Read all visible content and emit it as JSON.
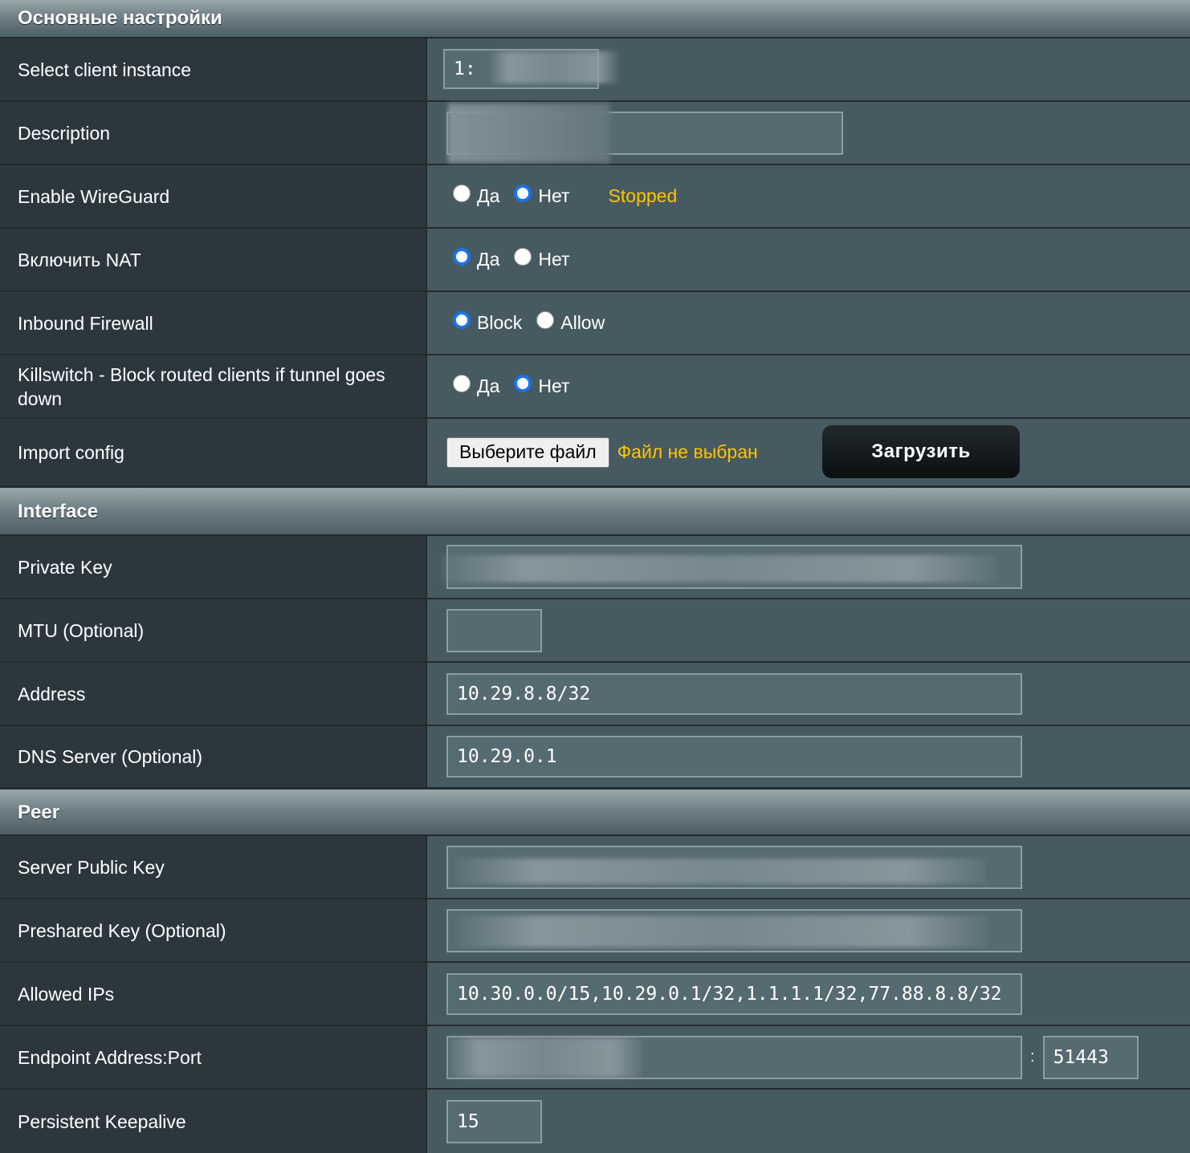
{
  "sections": {
    "basic": "Основные настройки",
    "interface": "Interface",
    "peer": "Peer"
  },
  "rows": {
    "client_instance": {
      "label": "Select client instance",
      "value": "1:"
    },
    "description": {
      "label": "Description",
      "value": ""
    },
    "enable_wireguard": {
      "label": "Enable WireGuard",
      "yes": "Да",
      "no": "Нет",
      "selected": "Нет",
      "status": "Stopped"
    },
    "nat": {
      "label": "Включить NAT",
      "yes": "Да",
      "no": "Нет",
      "selected": "Да"
    },
    "inbound_firewall": {
      "label": "Inbound Firewall",
      "block": "Block",
      "allow": "Allow",
      "selected": "Block"
    },
    "killswitch": {
      "label": "Killswitch - Block routed clients if tunnel goes down",
      "yes": "Да",
      "no": "Нет",
      "selected": "Нет"
    },
    "import_config": {
      "label": "Import config",
      "choose_file": "Выберите файл",
      "no_file": "Файл не выбран",
      "upload": "Загрузить"
    },
    "private_key": {
      "label": "Private Key",
      "value": ""
    },
    "mtu": {
      "label": "MTU (Optional)",
      "value": ""
    },
    "address": {
      "label": "Address",
      "value": "10.29.8.8/32"
    },
    "dns": {
      "label": "DNS Server (Optional)",
      "value": "10.29.0.1"
    },
    "server_public_key": {
      "label": "Server Public Key",
      "value": ""
    },
    "preshared_key": {
      "label": "Preshared Key (Optional)",
      "value": ""
    },
    "allowed_ips": {
      "label": "Allowed IPs",
      "value": "10.30.0.0/15,10.29.0.1/32,1.1.1.1/32,77.88.8.8/32"
    },
    "endpoint": {
      "label": "Endpoint Address:Port",
      "address": "",
      "separator": ":",
      "port": "51443"
    },
    "keepalive": {
      "label": "Persistent Keepalive",
      "value": "15"
    }
  },
  "colors": {
    "background": "#475a62",
    "label_background": "#2c373d",
    "status_yellow": "#ffc400",
    "radio_selected": "#1a73e8"
  }
}
